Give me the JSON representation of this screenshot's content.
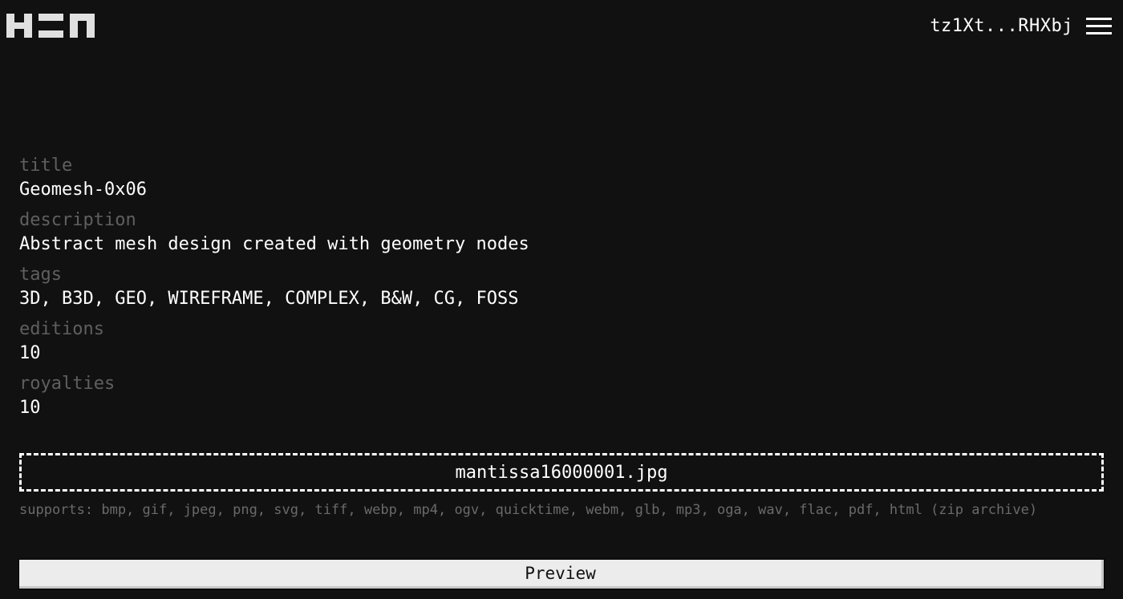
{
  "header": {
    "logo_icon": "hen-logo-icon",
    "wallet_address": "tz1Xt...RHXbj",
    "menu_icon": "hamburger-menu-icon"
  },
  "fields": [
    {
      "label": "title",
      "value": "Geomesh-0x06"
    },
    {
      "label": "description",
      "value": "Abstract mesh design created with geometry nodes"
    },
    {
      "label": "tags",
      "value": "3D, B3D, GEO, WIREFRAME, COMPLEX, B&W, CG, FOSS"
    },
    {
      "label": "editions",
      "value": "10"
    },
    {
      "label": "royalties",
      "value": "10"
    }
  ],
  "upload": {
    "filename": "mantissa16000001.jpg",
    "supports_text": "supports: bmp, gif, jpeg, png, svg, tiff, webp, mp4, ogv, quicktime, webm, glb, mp3, oga, wav, flac, pdf, html (zip archive)"
  },
  "actions": {
    "preview_label": "Preview"
  }
}
